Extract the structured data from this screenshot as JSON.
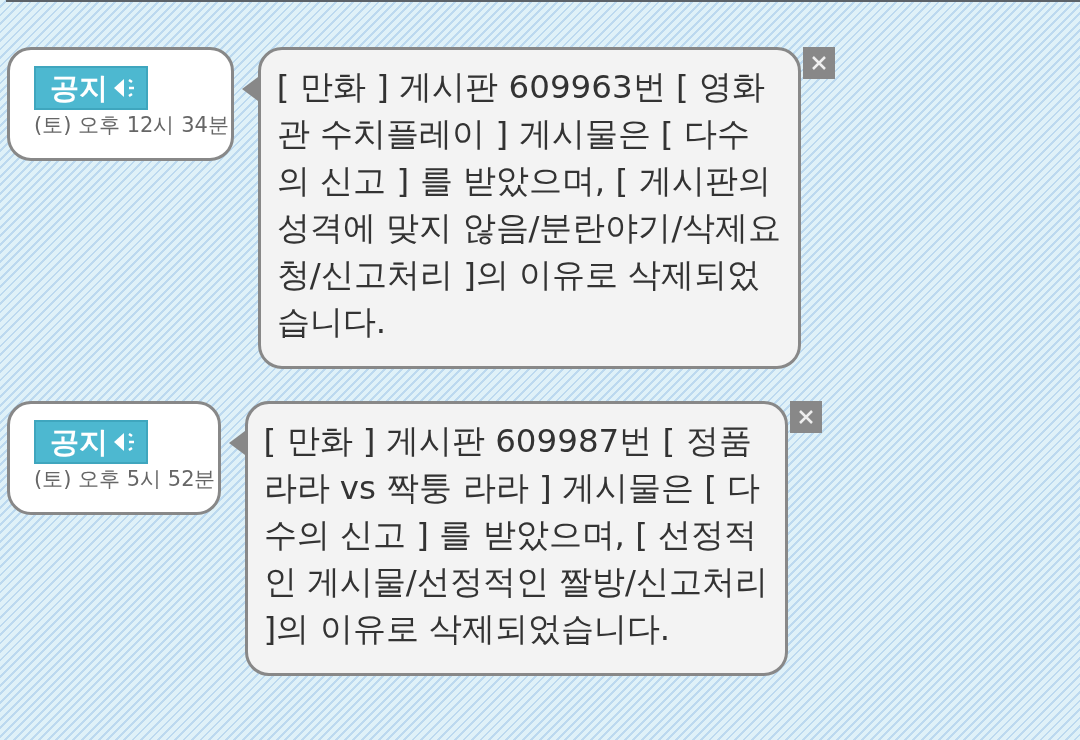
{
  "notices": [
    {
      "badge": "공지",
      "time": "(토) 오후 12시 34분",
      "message": "[ 만화 ] 게시판 609963번 [ 영화관 수치플레이 ] 게시물은 [ 다수의 신고 ] 를 받았으며, [ 게시판의 성격에 맞지 않음/분란야기/삭제요청/신고처리 ]의 이유로 삭제되었습니다."
    },
    {
      "badge": "공지",
      "time": "(토) 오후 5시 52분",
      "message": "[ 만화 ] 게시판 609987번 [ 정품라라 vs 짝퉁 라라 ] 게시물은 [ 다수의 신고 ] 를 받았으며, [ 선정적인 게시물/선정적인 짤방/신고처리 ]의 이유로 삭제되었습니다."
    }
  ]
}
